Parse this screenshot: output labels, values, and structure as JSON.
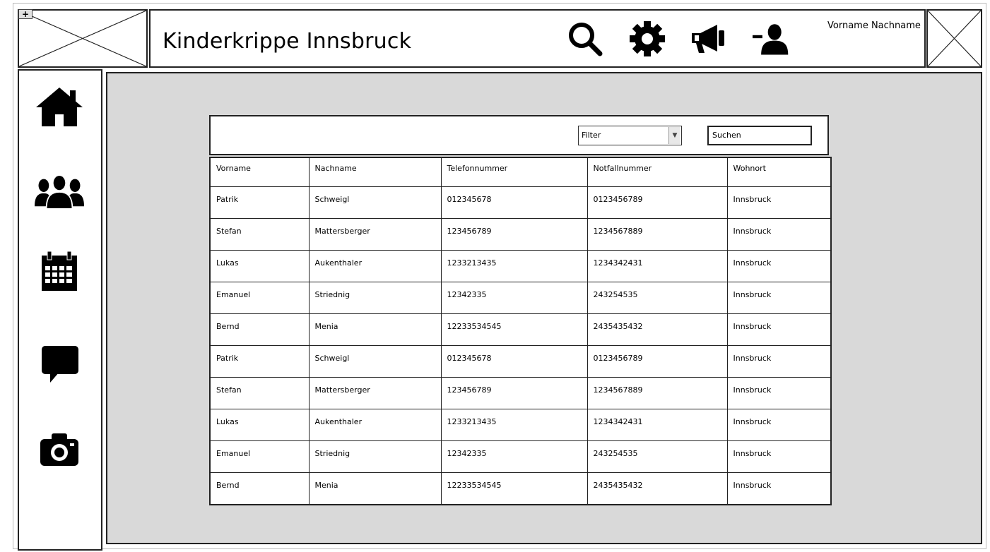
{
  "header": {
    "title": "Kinderkrippe Innsbruck",
    "user_name": "Vorname Nachname",
    "add_tag": "+",
    "icons": [
      "search-icon",
      "gear-icon",
      "megaphone-icon",
      "user-icon"
    ]
  },
  "sidebar": {
    "icons": [
      "home-icon",
      "group-icon",
      "calendar-icon",
      "chat-icon",
      "camera-icon"
    ]
  },
  "toolbar": {
    "filter_label": "Filter",
    "search_value": "Suchen"
  },
  "table": {
    "columns": [
      "Vorname",
      "Nachname",
      "Telefonnummer",
      "Notfallnummer",
      "Wohnort"
    ],
    "rows": [
      [
        "Patrik",
        "Schweigl",
        "012345678",
        "0123456789",
        "Innsbruck"
      ],
      [
        "Stefan",
        "Mattersberger",
        "123456789",
        "1234567889",
        "Innsbruck"
      ],
      [
        "Lukas",
        "Aukenthaler",
        "1233213435",
        "1234342431",
        "Innsbruck"
      ],
      [
        "Emanuel",
        "Striednig",
        "12342335",
        "243254535",
        "Innsbruck"
      ],
      [
        "Bernd",
        "Menia",
        "12233534545",
        "2435435432",
        "Innsbruck"
      ],
      [
        "Patrik",
        "Schweigl",
        "012345678",
        "0123456789",
        "Innsbruck"
      ],
      [
        "Stefan",
        "Mattersberger",
        "123456789",
        "1234567889",
        "Innsbruck"
      ],
      [
        "Lukas",
        "Aukenthaler",
        "1233213435",
        "1234342431",
        "Innsbruck"
      ],
      [
        "Emanuel",
        "Striednig",
        "12342335",
        "243254535",
        "Innsbruck"
      ],
      [
        "Bernd",
        "Menia",
        "12233534545",
        "2435435432",
        "Innsbruck"
      ]
    ]
  },
  "colors": {
    "main_background": "#d9d9d9",
    "stroke": "#222222"
  }
}
